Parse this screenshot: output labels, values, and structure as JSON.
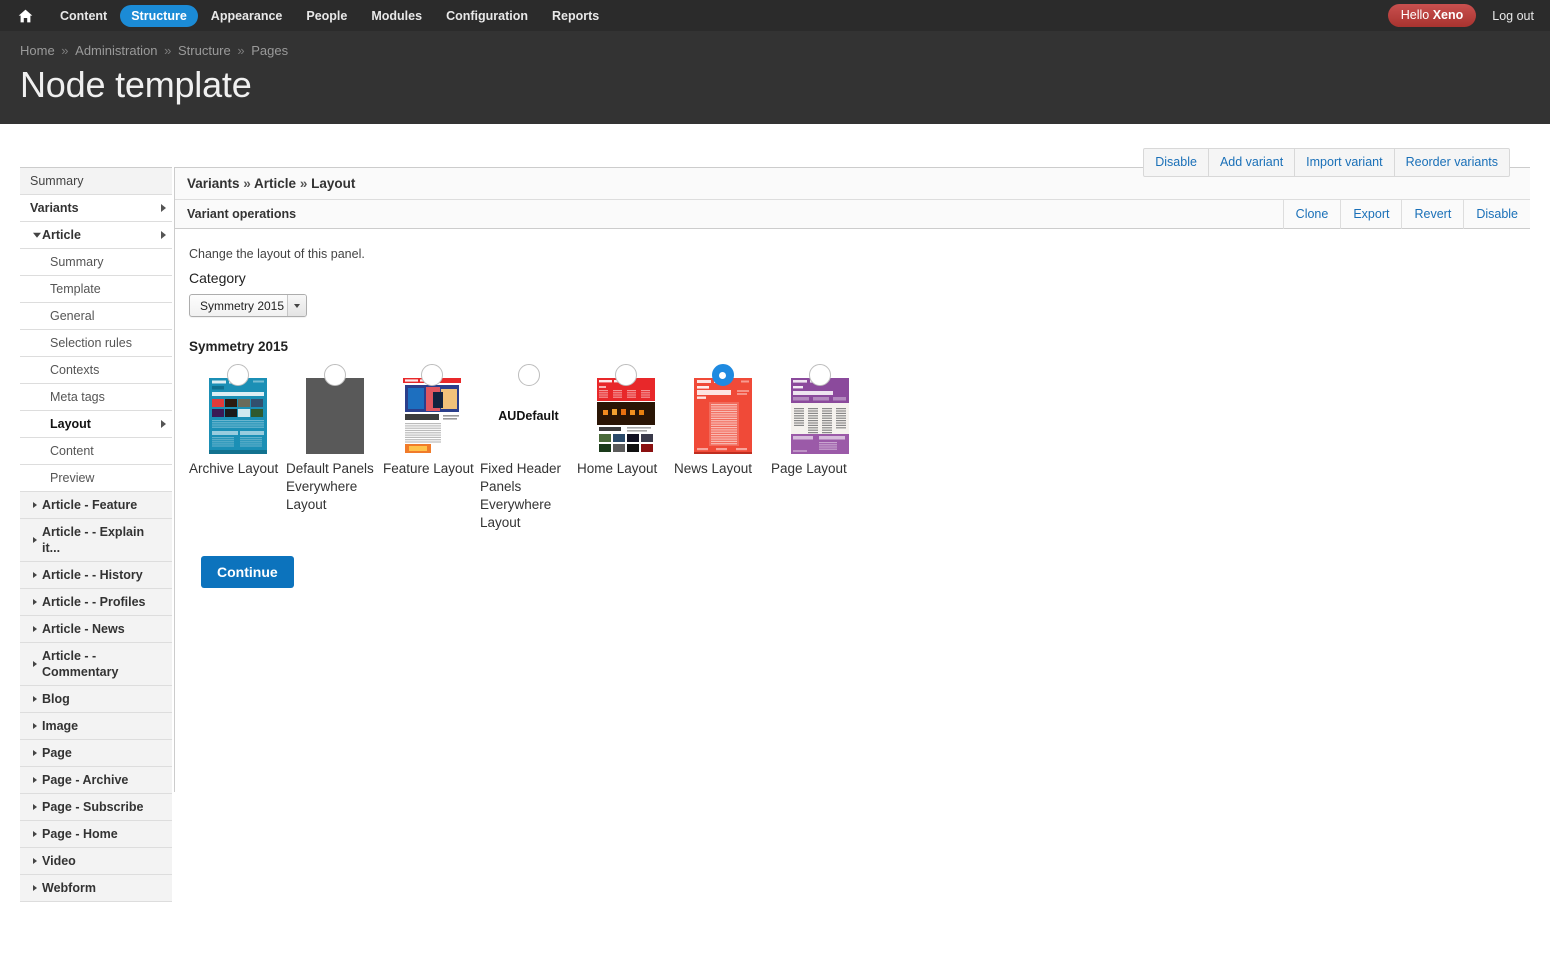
{
  "toolbar": {
    "home_icon": "home-icon",
    "items": [
      {
        "label": "Content",
        "active": false
      },
      {
        "label": "Structure",
        "active": true
      },
      {
        "label": "Appearance",
        "active": false
      },
      {
        "label": "People",
        "active": false
      },
      {
        "label": "Modules",
        "active": false
      },
      {
        "label": "Configuration",
        "active": false
      },
      {
        "label": "Reports",
        "active": false
      }
    ],
    "greeting_prefix": "Hello ",
    "user_name": "Xeno",
    "logout_label": "Log out",
    "active_color": "#1b8bd6",
    "badge_color": "#a8332f"
  },
  "header": {
    "breadcrumb": [
      "Home",
      "Administration",
      "Structure",
      "Pages"
    ],
    "breadcrumb_sep": "»",
    "title": "Node template"
  },
  "primary_actions": [
    {
      "label": "Disable"
    },
    {
      "label": "Add variant"
    },
    {
      "label": "Import variant"
    },
    {
      "label": "Reorder variants"
    }
  ],
  "sidebar": {
    "items": [
      {
        "label": "Summary",
        "level": 0,
        "bold": false,
        "shaded": true,
        "caret": "none",
        "selected": false
      },
      {
        "label": "Variants",
        "level": 0,
        "bold": true,
        "shaded": false,
        "caret": "right",
        "selected": false
      },
      {
        "label": "Article",
        "level": 1,
        "bold": true,
        "shaded": false,
        "caret": "right",
        "expanded": true,
        "selected": false
      },
      {
        "label": "Summary",
        "level": 2,
        "bold": false,
        "shaded": false,
        "caret": "none",
        "selected": false
      },
      {
        "label": "Template",
        "level": 2,
        "bold": false,
        "shaded": false,
        "caret": "none",
        "selected": false
      },
      {
        "label": "General",
        "level": 2,
        "bold": false,
        "shaded": false,
        "caret": "none",
        "selected": false
      },
      {
        "label": "Selection rules",
        "level": 2,
        "bold": false,
        "shaded": false,
        "caret": "none",
        "selected": false
      },
      {
        "label": "Contexts",
        "level": 2,
        "bold": false,
        "shaded": false,
        "caret": "none",
        "selected": false
      },
      {
        "label": "Meta tags",
        "level": 2,
        "bold": false,
        "shaded": false,
        "caret": "none",
        "selected": false
      },
      {
        "label": "Layout",
        "level": 2,
        "bold": true,
        "shaded": false,
        "caret": "right",
        "selected": true
      },
      {
        "label": "Content",
        "level": 2,
        "bold": false,
        "shaded": false,
        "caret": "none",
        "selected": false
      },
      {
        "label": "Preview",
        "level": 2,
        "bold": false,
        "shaded": false,
        "caret": "none",
        "selected": false
      },
      {
        "label": "Article - Feature",
        "level": 1,
        "bold": true,
        "shaded": true,
        "caret": "closed",
        "selected": false
      },
      {
        "label": "Article - - Explain it...",
        "level": 1,
        "bold": true,
        "shaded": true,
        "caret": "closed",
        "selected": false
      },
      {
        "label": "Article - - History",
        "level": 1,
        "bold": true,
        "shaded": true,
        "caret": "closed",
        "selected": false
      },
      {
        "label": "Article - - Profiles",
        "level": 1,
        "bold": true,
        "shaded": true,
        "caret": "closed",
        "selected": false
      },
      {
        "label": "Article - News",
        "level": 1,
        "bold": true,
        "shaded": true,
        "caret": "closed",
        "selected": false
      },
      {
        "label": "Article - - Commentary",
        "level": 1,
        "bold": true,
        "shaded": true,
        "caret": "closed",
        "selected": false
      },
      {
        "label": "Blog",
        "level": 1,
        "bold": true,
        "shaded": true,
        "caret": "closed",
        "selected": false
      },
      {
        "label": "Image",
        "level": 1,
        "bold": true,
        "shaded": true,
        "caret": "closed",
        "selected": false
      },
      {
        "label": "Page",
        "level": 1,
        "bold": true,
        "shaded": true,
        "caret": "closed",
        "selected": false
      },
      {
        "label": "Page - Archive",
        "level": 1,
        "bold": true,
        "shaded": true,
        "caret": "closed",
        "selected": false
      },
      {
        "label": "Page - Subscribe",
        "level": 1,
        "bold": true,
        "shaded": true,
        "caret": "closed",
        "selected": false
      },
      {
        "label": "Page - Home",
        "level": 1,
        "bold": true,
        "shaded": true,
        "caret": "closed",
        "selected": false
      },
      {
        "label": "Video",
        "level": 1,
        "bold": true,
        "shaded": true,
        "caret": "closed",
        "selected": false
      },
      {
        "label": "Webform",
        "level": 1,
        "bold": true,
        "shaded": true,
        "caret": "closed",
        "selected": false
      }
    ]
  },
  "main": {
    "panel_breadcrumb": [
      "Variants",
      "Article",
      "Layout"
    ],
    "panel_breadcrumb_sep": "»",
    "operations_label": "Variant operations",
    "operation_links": [
      {
        "label": "Clone"
      },
      {
        "label": "Export"
      },
      {
        "label": "Revert"
      },
      {
        "label": "Disable"
      }
    ],
    "hint": "Change the layout of this panel.",
    "category_label": "Category",
    "category_value": "Symmetry 2015",
    "group_title": "Symmetry 2015",
    "continue_label": "Continue",
    "layouts": [
      {
        "label": "Archive Layout",
        "selected": false,
        "thumb": "archive"
      },
      {
        "label": "Default Panels Everywhere Layout",
        "selected": false,
        "thumb": "gray"
      },
      {
        "label": "Feature Layout",
        "selected": false,
        "thumb": "feature"
      },
      {
        "label": "Fixed Header Panels Everywhere Layout",
        "selected": false,
        "thumb": "text",
        "thumb_text": "AU\nDefault"
      },
      {
        "label": "Home Layout",
        "selected": false,
        "thumb": "home"
      },
      {
        "label": "News Layout",
        "selected": true,
        "thumb": "news"
      },
      {
        "label": "Page Layout",
        "selected": false,
        "thumb": "page"
      }
    ]
  }
}
